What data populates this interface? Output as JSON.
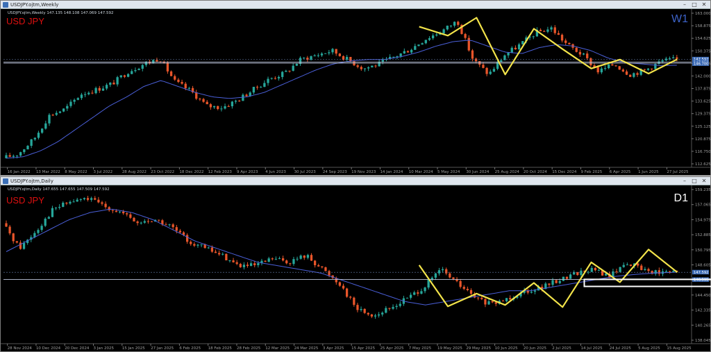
{
  "colors": {
    "bull": "#26a69a",
    "bear": "#e8552a",
    "ma": "#4a5fd8",
    "zigzag": "#f2e34a",
    "bg": "#000000",
    "grid": "#1c1c1c",
    "axis_text": "#a0a0a0",
    "box": "#ffffff"
  },
  "weekly": {
    "window_title": "USDJPY.ojtm,Weekly",
    "info_line": "USDJPY.ojtm,Weekly  147.135 148.108 147.069 147.592",
    "symbol": "USD JPY",
    "timeframe": "W1",
    "timeframe_color": "#3d63c9",
    "price_ticks": [
      "163.000",
      "158.875",
      "154.625",
      "150.375",
      "146.125",
      "142.000",
      "137.875",
      "133.625",
      "129.375",
      "125.125",
      "120.875",
      "116.750",
      "112.625"
    ],
    "current_price_labels": [
      "147.592",
      "147.058",
      "146.700"
    ],
    "date_labels": [
      "16 Jan 2022",
      "13 Mar 2022",
      "8 May 2022",
      "3 Jul 2022",
      "28 Aug 2022",
      "23 Oct 2022",
      "18 Dec 2022",
      "12 Feb 2023",
      "9 Apr 2023",
      "4 Jun 2023",
      "30 Jul 2023",
      "24 Sep 2023",
      "19 Nov 2023",
      "14 Jan 2024",
      "10 Mar 2024",
      "5 May 2024",
      "30 Jun 2024",
      "25 Aug 2024",
      "20 Oct 2024",
      "15 Dec 2024",
      "9 Feb 2025",
      "6 Apr 2025",
      "1 Jun 2025",
      "27 Jul 2025"
    ]
  },
  "daily": {
    "window_title": "USDJPY.ojtm,Daily",
    "info_line": "USDJPY.ojtm,Daily  147.655 147.655 147.509 147.592",
    "symbol": "USD JPY",
    "timeframe": "D1",
    "timeframe_color": "#ffffff",
    "price_ticks": [
      "159.235",
      "157.065",
      "154.975",
      "152.885",
      "150.795",
      "148.605",
      "146.515",
      "144.450",
      "142.335",
      "140.265",
      "138.045"
    ],
    "current_price_labels": [
      "147.592",
      "146.595"
    ],
    "date_labels": [
      "28 Nov 2024",
      "10 Dec 2024",
      "20 Dec 2024",
      "3 Jan 2025",
      "15 Jan 2025",
      "27 Jan 2025",
      "6 Feb 2025",
      "18 Feb 2025",
      "28 Feb 2025",
      "12 Mar 2025",
      "24 Mar 2025",
      "3 Apr 2025",
      "15 Apr 2025",
      "25 Apr 2025",
      "7 May 2025",
      "19 May 2025",
      "29 May 2025",
      "10 Jun 2025",
      "20 Jun 2025",
      "2 Jul 2025",
      "14 Jul 2025",
      "24 Jul 2025",
      "5 Aug 2025",
      "15 Aug 2025"
    ]
  },
  "chart_data": [
    {
      "type": "line",
      "name": "weekly",
      "ylim": [
        112.625,
        163.0
      ],
      "x_categories": [
        "16 Jan 2022",
        "13 Mar 2022",
        "8 May 2022",
        "3 Jul 2022",
        "28 Aug 2022",
        "23 Oct 2022",
        "18 Dec 2022",
        "12 Feb 2023",
        "9 Apr 2023",
        "4 Jun 2023",
        "30 Jul 2023",
        "24 Sep 2023",
        "19 Nov 2023",
        "14 Jan 2024",
        "10 Mar 2024",
        "5 May 2024",
        "30 Jun 2024",
        "25 Aug 2024",
        "20 Oct 2024",
        "15 Dec 2024",
        "9 Feb 2025",
        "6 Apr 2025",
        "1 Jun 2025",
        "27 Jul 2025"
      ],
      "close_path": [
        114.5,
        116.0,
        121.0,
        129.0,
        131.0,
        136.0,
        137.5,
        139.5,
        143.5,
        146.0,
        148.0,
        140.0,
        137.0,
        132.0,
        131.5,
        134.0,
        137.5,
        141.0,
        143.0,
        147.5,
        149.0,
        150.5,
        147.5,
        144.5,
        146.0,
        148.5,
        151.0,
        154.5,
        157.0,
        160.5,
        147.5,
        142.5,
        149.0,
        152.5,
        156.5,
        158.0,
        152.5,
        149.0,
        143.5,
        146.0,
        142.5,
        144.0,
        147.0,
        147.6
      ],
      "ma_path": [
        114.5,
        115.0,
        117.0,
        120.0,
        124.0,
        128.0,
        132.0,
        135.0,
        138.5,
        140.5,
        138.5,
        136.5,
        135.0,
        134.5,
        135.0,
        136.5,
        139.0,
        141.5,
        144.0,
        146.0,
        147.0,
        147.5,
        147.5,
        148.5,
        150.0,
        152.0,
        153.5,
        154.0,
        152.0,
        150.0,
        149.5,
        151.5,
        152.5,
        152.0,
        150.5,
        148.0,
        146.5,
        146.0,
        145.5,
        145.6
      ],
      "zigzag": [
        {
          "x": "10 Mar 2024",
          "y": 158.5
        },
        {
          "x": "5 May 2024",
          "y": 155.5
        },
        {
          "x": "30 Jun 2024",
          "y": 161.5
        },
        {
          "x": "25 Aug 2024",
          "y": 142.5
        },
        {
          "x": "20 Oct 2024",
          "y": 157.8
        },
        {
          "x": "15 Dec 2024",
          "y": 151.0
        },
        {
          "x": "9 Feb 2025",
          "y": 144.5
        },
        {
          "x": "6 Apr 2025",
          "y": 147.5
        },
        {
          "x": "1 Jun 2025",
          "y": 142.8
        },
        {
          "x": "27 Jul 2025",
          "y": 147.6
        }
      ]
    },
    {
      "type": "line",
      "name": "daily",
      "ylim": [
        138.045,
        159.235
      ],
      "x_categories": [
        "28 Nov 2024",
        "10 Dec 2024",
        "20 Dec 2024",
        "3 Jan 2025",
        "15 Jan 2025",
        "27 Jan 2025",
        "6 Feb 2025",
        "18 Feb 2025",
        "28 Feb 2025",
        "12 Mar 2025",
        "24 Mar 2025",
        "3 Apr 2025",
        "15 Apr 2025",
        "25 Apr 2025",
        "7 May 2025",
        "19 May 2025",
        "29 May 2025",
        "10 Jun 2025",
        "20 Jun 2025",
        "2 Jul 2025",
        "14 Jul 2025",
        "24 Jul 2025",
        "5 Aug 2025",
        "15 Aug 2025"
      ],
      "close_path": [
        154.5,
        151.0,
        153.5,
        156.5,
        157.5,
        158.0,
        157.0,
        156.0,
        154.5,
        155.0,
        154.0,
        152.0,
        151.0,
        150.0,
        148.5,
        148.5,
        149.5,
        149.0,
        150.0,
        148.0,
        146.0,
        142.5,
        141.5,
        142.5,
        144.0,
        145.5,
        148.0,
        146.0,
        144.0,
        143.0,
        144.0,
        145.0,
        145.5,
        146.5,
        147.5,
        148.0,
        147.0,
        149.0,
        148.0,
        147.5,
        147.6
      ],
      "ma_path": [
        150.5,
        152.0,
        153.5,
        155.0,
        156.0,
        156.5,
        156.0,
        155.0,
        153.5,
        152.0,
        151.0,
        150.0,
        149.0,
        148.5,
        148.0,
        147.5,
        146.5,
        145.5,
        144.5,
        143.5,
        143.0,
        143.5,
        144.0,
        144.5,
        145.0,
        145.0,
        145.5,
        146.0,
        146.5,
        147.0,
        147.3,
        147.5,
        147.6
      ],
      "zigzag": [
        {
          "x": "7 May 2025",
          "y": 148.6
        },
        {
          "x": "19 May 2025",
          "y": 142.8
        },
        {
          "x": "29 May 2025",
          "y": 144.6
        },
        {
          "x": "10 Jun 2025",
          "y": 143.0
        },
        {
          "x": "20 Jun 2025",
          "y": 146.1
        },
        {
          "x": "2 Jul 2025",
          "y": 142.7
        },
        {
          "x": "14 Jul 2025",
          "y": 149.0
        },
        {
          "x": "24 Jul 2025",
          "y": 146.2
        },
        {
          "x": "5 Aug 2025",
          "y": 150.8
        },
        {
          "x": "15 Aug 2025",
          "y": 147.6
        }
      ],
      "support_zone": [
        146.0,
        146.6
      ]
    }
  ]
}
